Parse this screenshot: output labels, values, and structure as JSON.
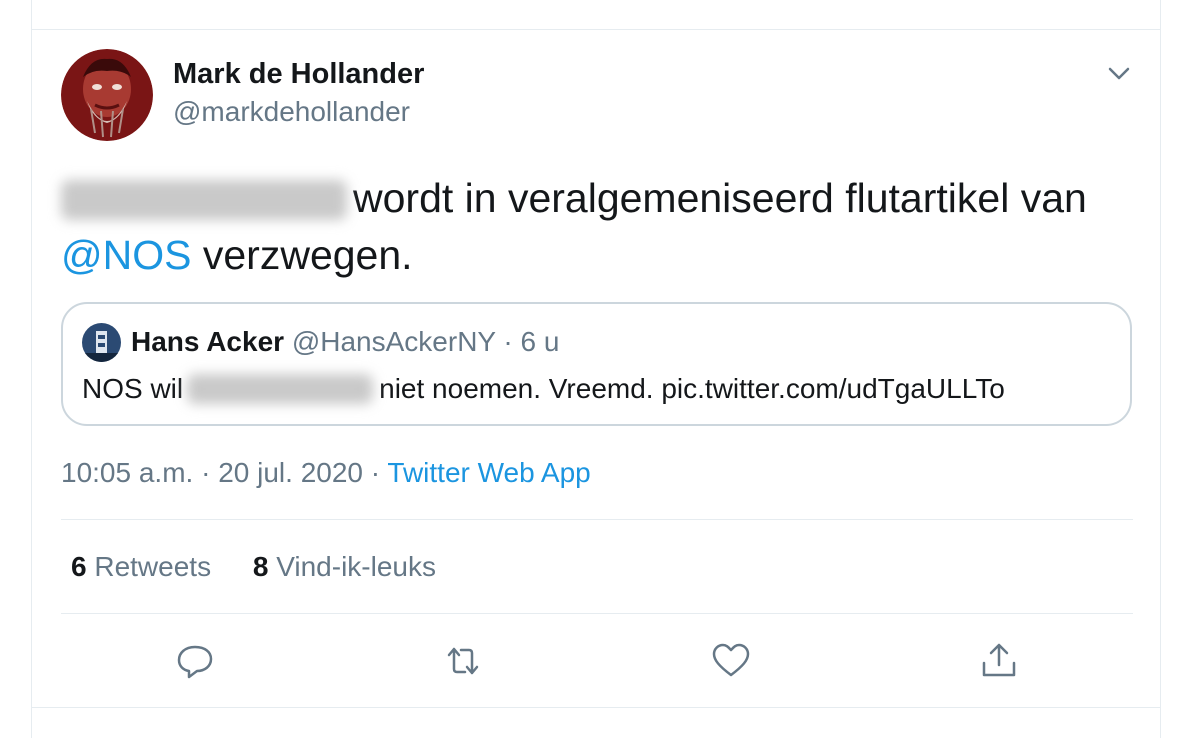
{
  "tweet": {
    "author_name": "Mark de Hollander",
    "author_handle": "@markdehollander",
    "text_after_redaction": "wordt in veralgemeniseerd flutartikel van",
    "mention": "@NOS",
    "text_end": "verzwegen.",
    "time": "10:05 a.m.",
    "date": "20 jul. 2020",
    "separator": "·",
    "app": "Twitter Web App",
    "retweets_count": "6",
    "retweets_label": "Retweets",
    "likes_count": "8",
    "likes_label": "Vind-ik-leuks"
  },
  "quote": {
    "author_name": "Hans Acker",
    "author_handle": "@HansAckerNY",
    "separator": "·",
    "age": "6 u",
    "text_before": "NOS wil",
    "text_after": "niet noemen. Vreemd. pic.twitter.com/udTgaULLTo"
  },
  "icons": {
    "more": "chevron-down-icon",
    "reply": "reply-icon",
    "retweet": "retweet-icon",
    "like": "heart-icon",
    "share": "share-icon"
  },
  "colors": {
    "link": "#1b95e0",
    "secondary_text": "#657786",
    "border": "#ccd6dd",
    "avatar_red": "#8b1a1a"
  }
}
